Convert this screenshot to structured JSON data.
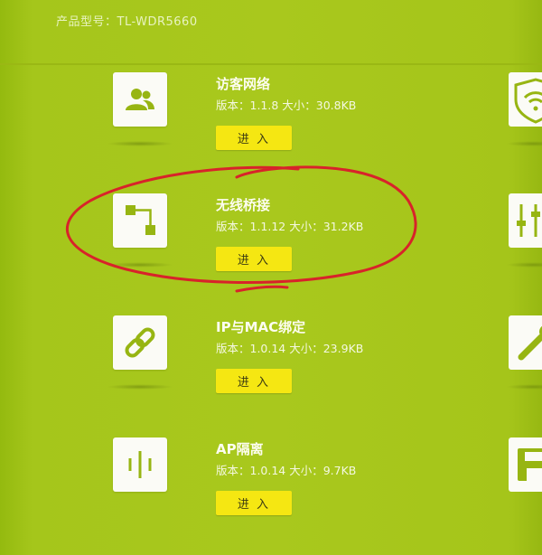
{
  "header": {
    "model_label": "产品型号：TL-WDR5660"
  },
  "apps": [
    {
      "name": "访客网络",
      "meta": "版本：1.1.8  大小：30.8KB",
      "enter": "进 入",
      "icon": "guest-users-icon"
    },
    {
      "name": "无线桥接",
      "meta": "版本：1.1.12  大小：31.2KB",
      "enter": "进 入",
      "icon": "bridge-nodes-icon"
    },
    {
      "name": "IP与MAC绑定",
      "meta": "版本：1.0.14  大小：23.9KB",
      "enter": "进 入",
      "icon": "chain-link-icon"
    },
    {
      "name": "AP隔离",
      "meta": "版本：1.0.14  大小：9.7KB",
      "enter": "进 入",
      "icon": "isolation-bars-icon"
    }
  ],
  "right_column_icons": [
    "wifi-shield-icon",
    "sliders-icon",
    "wrench-icon",
    "save-icon"
  ],
  "colors": {
    "background": "#a9c81d",
    "button": "#f5e712",
    "tile": "#fbfbf6",
    "icon": "#97b512",
    "annotation": "#d8232a"
  }
}
